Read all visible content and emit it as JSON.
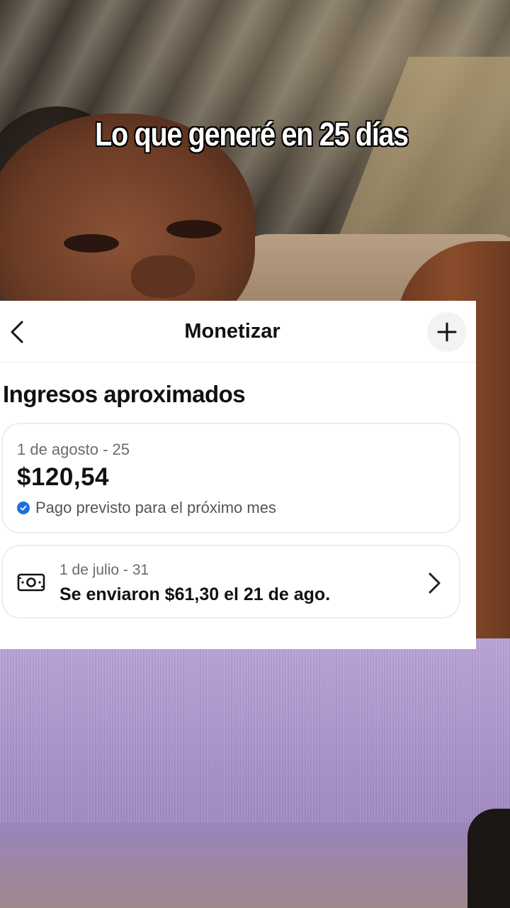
{
  "overlay": {
    "caption": "Lo que generé en 25 días"
  },
  "header": {
    "title": "Monetizar",
    "back_icon": "chevron-left-icon",
    "add_icon": "plus-icon"
  },
  "section": {
    "title": "Ingresos aproximados"
  },
  "earnings_card": {
    "date_range": "1 de agosto - 25",
    "amount": "$120,54",
    "status_icon": "check-circle-icon",
    "status_text": "Pago previsto para el próximo mes"
  },
  "payout_card": {
    "icon": "money-bill-icon",
    "date_range": "1 de julio - 31",
    "text": "Se enviaron $61,30 el 21 de ago.",
    "chevron_icon": "chevron-right-icon"
  },
  "colors": {
    "accent": "#1f6fde",
    "panel_bg": "#ffffff",
    "text_primary": "#111111",
    "text_secondary": "#6b6b6b"
  }
}
